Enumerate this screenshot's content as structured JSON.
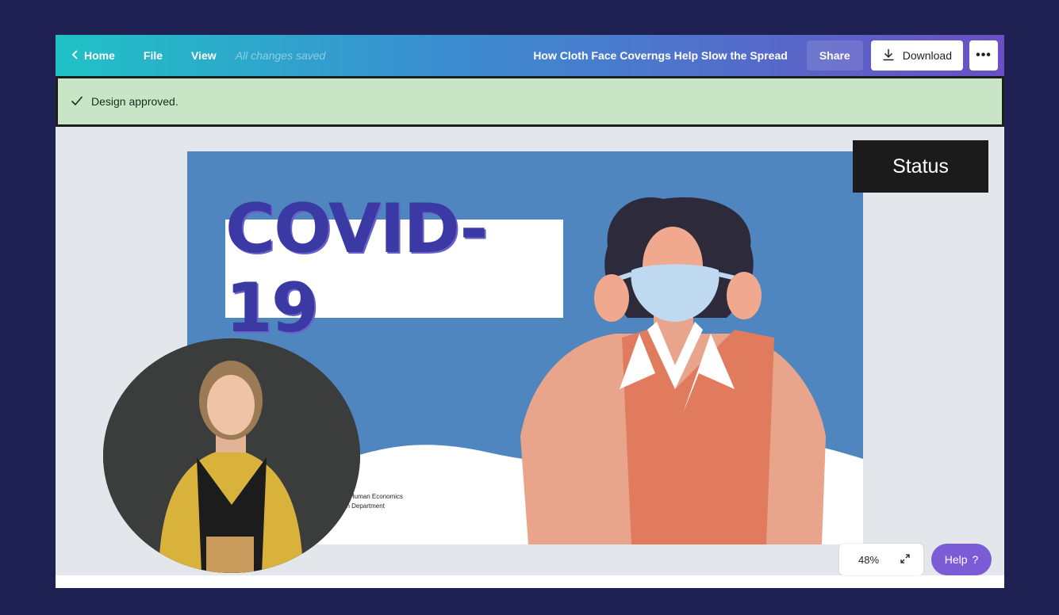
{
  "topbar": {
    "home": "Home",
    "file": "File",
    "view": "View",
    "saved_status": "All changes saved",
    "title": "How Cloth Face Coverngs Help Slow the Spread",
    "share": "Share",
    "download": "Download",
    "more": "•••"
  },
  "banner": {
    "message": "Design approved."
  },
  "slide": {
    "headline": "COVID-19",
    "caption_line1": "of Human Economics",
    "caption_line2": "gn Department"
  },
  "status_tag": "Status",
  "zoom": {
    "level": "48%"
  },
  "help": {
    "label": "Help",
    "icon": "?"
  },
  "colors": {
    "outer_bg": "#1e2152",
    "slide_blue": "#4f86c0",
    "banner_green": "#c8e6c6",
    "help_purple": "#7b5cd6",
    "headline": "#3b3aa4"
  }
}
